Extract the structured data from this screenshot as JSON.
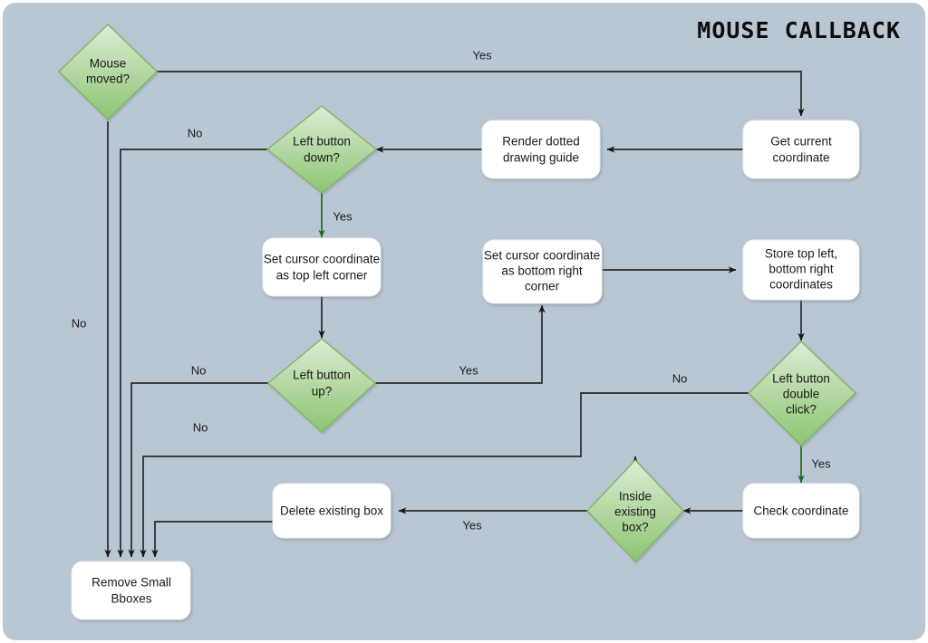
{
  "canvas": {
    "title": "MOUSE CALLBACK",
    "background_color": "#b9c7d4",
    "page_color": "#ffffff"
  },
  "theme": {
    "decision_fill_top": "#dcecd5",
    "decision_fill_bottom": "#8cc471",
    "decision_stroke": "#82b366",
    "process_fill": "#ffffff",
    "connector_color": "#282828",
    "connector_green": "#1e6b1e",
    "text_color": "#1a1a1a"
  },
  "nodes": [
    {
      "id": "mouse-moved",
      "type": "decision",
      "label": "Mouse\nmoved?"
    },
    {
      "id": "get-coord",
      "type": "process",
      "label": "Get current\ncoordinate"
    },
    {
      "id": "render-guide",
      "type": "process",
      "label": "Render dotted\ndrawing guide"
    },
    {
      "id": "left-button-down",
      "type": "decision",
      "label": "Left button\ndown?"
    },
    {
      "id": "set-top-left",
      "type": "process",
      "label": "Set cursor coordinate\nas top left corner"
    },
    {
      "id": "set-bottom-right",
      "type": "process",
      "label": "Set cursor coordinate\nas bottom right\ncorner"
    },
    {
      "id": "store-coords",
      "type": "process",
      "label": "Store top left,\nbottom right\ncoordinates"
    },
    {
      "id": "left-button-up",
      "type": "decision",
      "label": "Left button\nup?"
    },
    {
      "id": "left-double-click",
      "type": "decision",
      "label": "Left button\ndouble\nclick?"
    },
    {
      "id": "check-coordinate",
      "type": "process",
      "label": "Check coordinate"
    },
    {
      "id": "inside-existing",
      "type": "decision",
      "label": "Inside\nexisting\nbox?"
    },
    {
      "id": "delete-box",
      "type": "process",
      "label": "Delete existing box"
    },
    {
      "id": "remove-small",
      "type": "process",
      "label": "Remove Small\nBboxes"
    }
  ],
  "edge_labels": {
    "mouse_moved_yes": "Yes",
    "mouse_moved_no": "No",
    "button_down_no": "No",
    "button_down_yes": "Yes",
    "button_up_no": "No",
    "button_up_yes": "Yes",
    "double_click_no": "No",
    "double_click_yes": "Yes",
    "inside_box_no": "No",
    "inside_box_yes": "Yes"
  },
  "node_text": {
    "mouse_moved_l1": "Mouse",
    "mouse_moved_l2": "moved?",
    "get_coord_l1": "Get current",
    "get_coord_l2": "coordinate",
    "render_guide_l1": "Render dotted",
    "render_guide_l2": "drawing guide",
    "button_down_l1": "Left button",
    "button_down_l2": "down?",
    "set_tl_l1": "Set cursor coordinate",
    "set_tl_l2": "as top left corner",
    "set_br_l1": "Set cursor coordinate",
    "set_br_l2": "as bottom right",
    "set_br_l3": "corner",
    "store_l1": "Store top left,",
    "store_l2": "bottom right",
    "store_l3": "coordinates",
    "button_up_l1": "Left button",
    "button_up_l2": "up?",
    "dbl_click_l1": "Left button",
    "dbl_click_l2": "double",
    "dbl_click_l3": "click?",
    "check_coord_l1": "Check coordinate",
    "inside_l1": "Inside",
    "inside_l2": "existing",
    "inside_l3": "box?",
    "delete_l1": "Delete existing box",
    "remove_l1": "Remove Small",
    "remove_l2": "Bboxes"
  },
  "chart_data": {
    "type": "table",
    "title": "MOUSE CALLBACK",
    "nodes": [
      "Mouse moved?",
      "Get current coordinate",
      "Render dotted drawing guide",
      "Left button down?",
      "Set cursor coordinate as top left corner",
      "Left button up?",
      "Set cursor coordinate as bottom right corner",
      "Store top left, bottom right coordinates",
      "Left button double click?",
      "Check coordinate",
      "Inside existing box?",
      "Delete existing box",
      "Remove Small Bboxes"
    ],
    "edges": [
      {
        "from": "Mouse moved?",
        "to": "Get current coordinate",
        "label": "Yes"
      },
      {
        "from": "Mouse moved?",
        "to": "Remove Small Bboxes",
        "label": "No"
      },
      {
        "from": "Get current coordinate",
        "to": "Render dotted drawing guide",
        "label": ""
      },
      {
        "from": "Render dotted drawing guide",
        "to": "Left button down?",
        "label": ""
      },
      {
        "from": "Left button down?",
        "to": "Remove Small Bboxes",
        "label": "No"
      },
      {
        "from": "Left button down?",
        "to": "Set cursor coordinate as top left corner",
        "label": "Yes"
      },
      {
        "from": "Set cursor coordinate as top left corner",
        "to": "Left button up?",
        "label": ""
      },
      {
        "from": "Left button up?",
        "to": "Remove Small Bboxes",
        "label": "No"
      },
      {
        "from": "Left button up?",
        "to": "Set cursor coordinate as bottom right corner",
        "label": "Yes"
      },
      {
        "from": "Set cursor coordinate as bottom right corner",
        "to": "Store top left, bottom right coordinates",
        "label": ""
      },
      {
        "from": "Store top left, bottom right coordinates",
        "to": "Left button double click?",
        "label": ""
      },
      {
        "from": "Left button double click?",
        "to": "Remove Small Bboxes",
        "label": "No"
      },
      {
        "from": "Left button double click?",
        "to": "Check coordinate",
        "label": "Yes"
      },
      {
        "from": "Check coordinate",
        "to": "Inside existing box?",
        "label": ""
      },
      {
        "from": "Inside existing box?",
        "to": "Remove Small Bboxes",
        "label": "No"
      },
      {
        "from": "Inside existing box?",
        "to": "Delete existing box",
        "label": "Yes"
      },
      {
        "from": "Delete existing box",
        "to": "Remove Small Bboxes",
        "label": ""
      }
    ]
  }
}
